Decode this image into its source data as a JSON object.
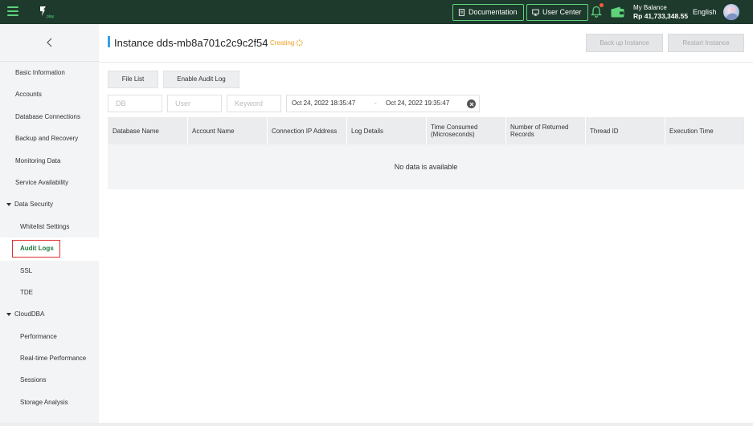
{
  "topbar": {
    "documentation_label": "Documentation",
    "user_center_label": "User Center",
    "balance_label": "My Balance",
    "balance_amount": "Rp 41,733,348.55",
    "language": "English",
    "accent_color": "#5fd37a",
    "bg_color": "#1d3a2d"
  },
  "sidebar": {
    "items": [
      {
        "label": "Basic Information"
      },
      {
        "label": "Accounts"
      },
      {
        "label": "Database Connections"
      },
      {
        "label": "Backup and Recovery"
      },
      {
        "label": "Monitoring Data"
      },
      {
        "label": "Service Availability"
      }
    ],
    "data_security": {
      "label": "Data Security",
      "children": [
        {
          "label": "Whitelist Settings"
        },
        {
          "label": "Audit Logs",
          "active": true
        },
        {
          "label": "SSL"
        },
        {
          "label": "TDE"
        }
      ]
    },
    "clouddba": {
      "label": "CloudDBA",
      "children": [
        {
          "label": "Performance"
        },
        {
          "label": "Real-time Performance"
        },
        {
          "label": "Sessions"
        },
        {
          "label": "Storage Analysis"
        }
      ]
    }
  },
  "header": {
    "title": "Instance dds-mb8a701c2c9c2f54",
    "status": "Creating",
    "backup_label": "Back up Instance",
    "restart_label": "Restart Instance"
  },
  "toolbar": {
    "file_list_label": "File List",
    "enable_audit_label": "Enable Audit Log"
  },
  "filters": {
    "db_placeholder": "DB",
    "user_placeholder": "User",
    "keyword_placeholder": "Keyword",
    "start_time": "Oct 24, 2022 18:35:47",
    "separator": "-",
    "end_time": "Oct 24, 2022 19:35:47"
  },
  "table": {
    "columns": [
      "Database Name",
      "Account Name",
      "Connection IP Address",
      "Log Details",
      "Time Consumed (Microseconds)",
      "Number of Returned Records",
      "Thread ID",
      "Execution Time"
    ],
    "empty_text": "No data is available"
  }
}
